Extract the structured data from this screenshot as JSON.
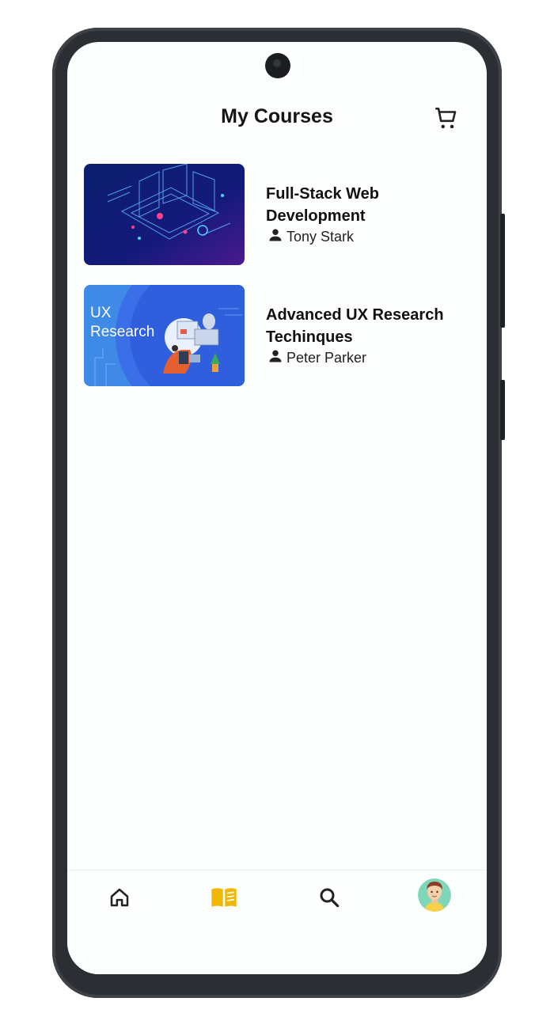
{
  "header": {
    "title": "My Courses",
    "cart_icon": "cart-icon"
  },
  "courses": [
    {
      "title": "Full-Stack Web Development",
      "author": "Tony Stark",
      "thumbnail": "web-development-illustration"
    },
    {
      "title": "Advanced UX Research Techinques",
      "author": "Peter Parker",
      "thumbnail": "ux-research-illustration",
      "thumbnail_text_line1": "UX",
      "thumbnail_text_line2": "Research"
    }
  ],
  "nav": {
    "items": [
      "home-icon",
      "book-icon",
      "search-icon",
      "profile-avatar"
    ],
    "active_color": "#F2B705",
    "inactive_color": "#222222"
  },
  "colors": {
    "phone_frame": "#2B2F33",
    "screen_bg": "#FCFDFD",
    "text": "#111111"
  }
}
